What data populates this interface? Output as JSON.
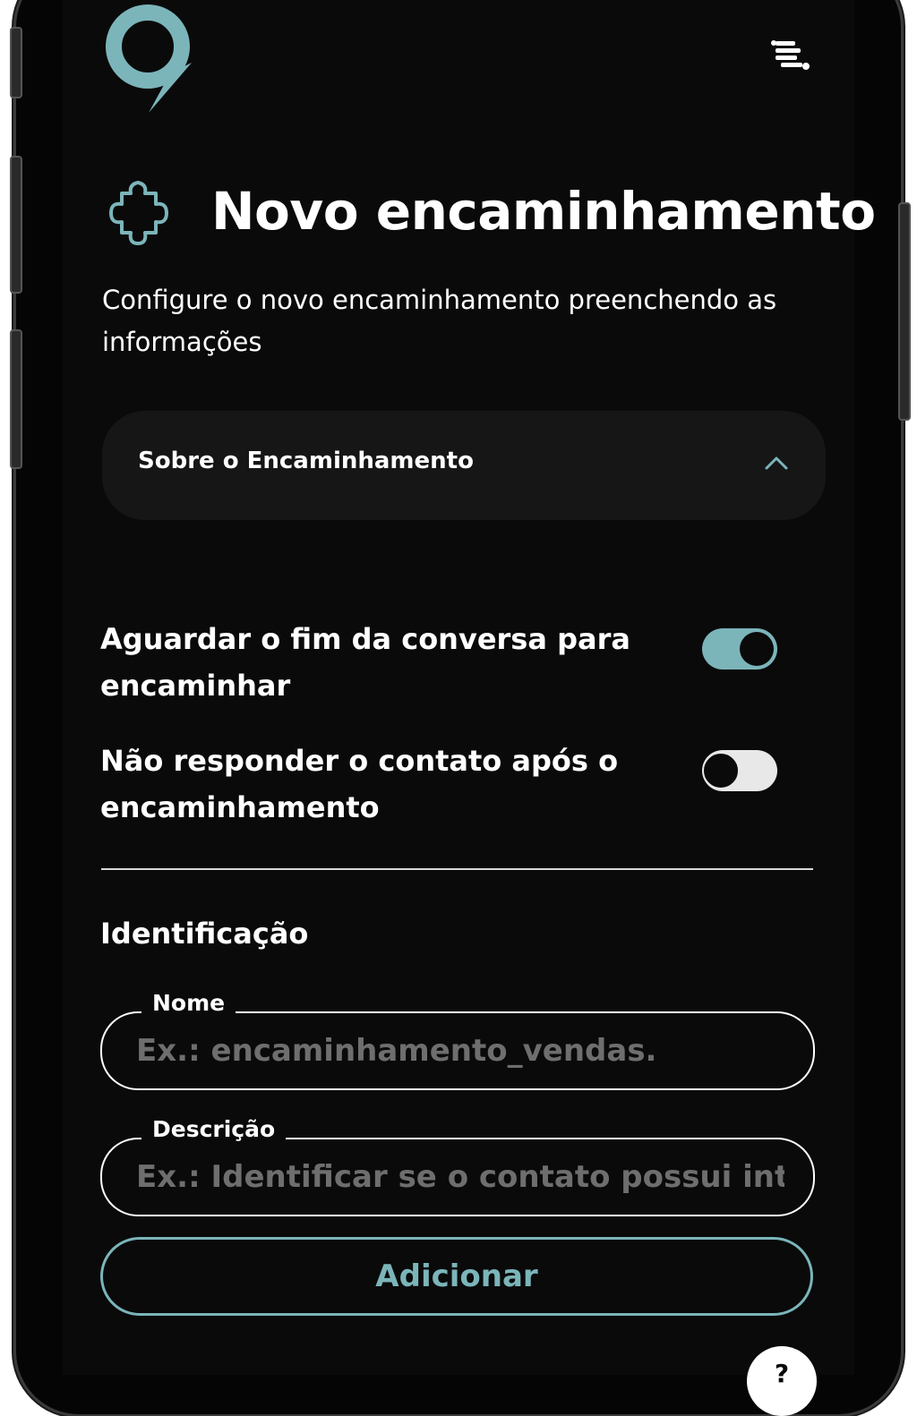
{
  "header": {
    "logo_icon": "speech-bubble-logo-icon",
    "menu_icon": "menu-list-icon"
  },
  "page": {
    "title": "Novo encaminhamento",
    "title_icon": "puzzle-icon",
    "subtitle": "Configure o novo encaminhamento preenchendo as informações"
  },
  "accordion": {
    "label": "Sobre o Encaminhamento",
    "expanded": true,
    "icon": "chevron-up-icon"
  },
  "toggles": [
    {
      "label": "Aguardar o fim da conversa para encaminhar",
      "checked": true
    },
    {
      "label": "Não responder o contato após o encaminhamento",
      "checked": false
    }
  ],
  "identification": {
    "title": "Identificação",
    "name_field": {
      "label": "Nome",
      "value": "",
      "placeholder": "Ex.: encaminhamento_vendas."
    },
    "description_field": {
      "label": "Descrição",
      "value": "",
      "placeholder": "Ex.: Identificar se o contato possui inteiç"
    }
  },
  "actions": {
    "add_label": "Adicionar"
  },
  "help": {
    "label": "?",
    "icon": "help-icon"
  },
  "colors": {
    "accent": "#7bb5ba",
    "background": "#0a0a0a",
    "card": "#161616",
    "text": "#ffffff",
    "placeholder": "#6e6e6e"
  }
}
